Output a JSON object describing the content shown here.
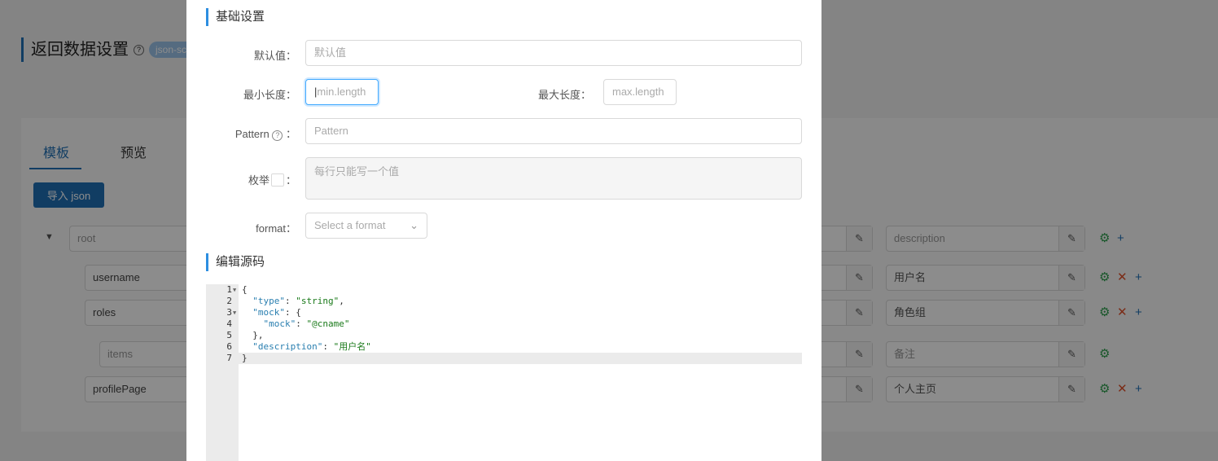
{
  "background": {
    "title": "返回数据设置",
    "tag": "json-sch",
    "tabs": [
      "模板",
      "预览"
    ],
    "import_button": "导入 json",
    "rows": [
      {
        "name": "root",
        "desc": "description",
        "placeholder": true,
        "actions": [
          "setting",
          "add"
        ]
      },
      {
        "name": "username",
        "desc": "用户名",
        "placeholder": false,
        "actions": [
          "setting",
          "delete",
          "add"
        ]
      },
      {
        "name": "roles",
        "desc": "角色组",
        "placeholder": false,
        "actions": [
          "setting",
          "delete",
          "add"
        ]
      },
      {
        "name": "items",
        "desc": "备注",
        "placeholder": true,
        "actions": [
          "setting"
        ]
      },
      {
        "name": "profilePage",
        "desc": "个人主页",
        "placeholder": false,
        "actions": [
          "setting",
          "delete",
          "add"
        ]
      }
    ]
  },
  "modal": {
    "basic_title": "基础设置",
    "default_label": "默认值：",
    "default_placeholder": "默认值",
    "min_label": "最小长度：",
    "min_placeholder": "min.length",
    "max_label": "最大长度：",
    "max_placeholder": "max.length",
    "pattern_label": "Pattern",
    "pattern_colon": "：",
    "pattern_placeholder": "Pattern",
    "enum_label": "枚举",
    "enum_colon": "：",
    "enum_placeholder": "每行只能写一个值",
    "format_label": "format：",
    "format_placeholder": "Select a format",
    "source_title": "编辑源码",
    "code": [
      {
        "n": "1",
        "fold": true,
        "parts": [
          [
            "p",
            "{"
          ]
        ]
      },
      {
        "n": "2",
        "fold": false,
        "parts": [
          [
            "p",
            "  "
          ],
          [
            "k",
            "\"type\""
          ],
          [
            "p",
            ": "
          ],
          [
            "s",
            "\"string\""
          ],
          [
            "p",
            ","
          ]
        ]
      },
      {
        "n": "3",
        "fold": true,
        "parts": [
          [
            "p",
            "  "
          ],
          [
            "k",
            "\"mock\""
          ],
          [
            "p",
            ": {"
          ]
        ]
      },
      {
        "n": "4",
        "fold": false,
        "parts": [
          [
            "p",
            "    "
          ],
          [
            "k",
            "\"mock\""
          ],
          [
            "p",
            ": "
          ],
          [
            "s",
            "\"@cname\""
          ]
        ]
      },
      {
        "n": "5",
        "fold": false,
        "parts": [
          [
            "p",
            "  },"
          ]
        ]
      },
      {
        "n": "6",
        "fold": false,
        "parts": [
          [
            "p",
            "  "
          ],
          [
            "k",
            "\"description\""
          ],
          [
            "p",
            ": "
          ],
          [
            "s",
            "\"用户名\""
          ]
        ]
      },
      {
        "n": "7",
        "fold": false,
        "parts": [
          [
            "p",
            "}"
          ]
        ]
      }
    ]
  },
  "colors": {
    "primary": "#1f6fb5",
    "accent": "#2d8ee0",
    "setting": "#2e9e4e",
    "delete": "#e0502a"
  }
}
